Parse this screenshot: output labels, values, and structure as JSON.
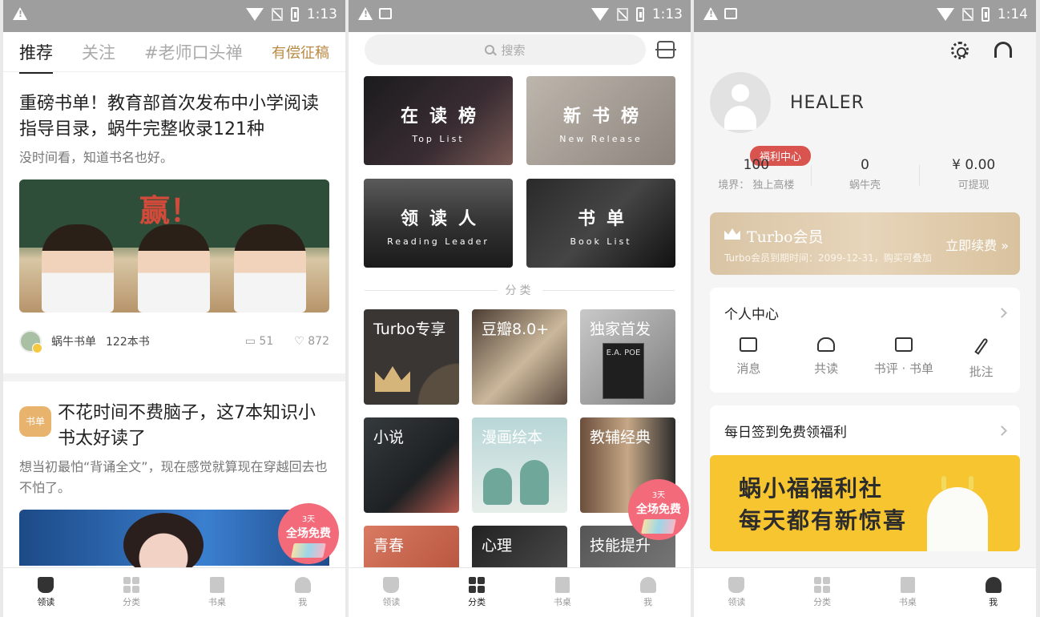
{
  "status": {
    "p1_time": "1:13",
    "p2_time": "1:13",
    "p3_time": "1:14"
  },
  "tabs": [
    "领读",
    "分类",
    "书桌",
    "我"
  ],
  "panel1": {
    "nav": [
      "推荐",
      "关注",
      "#老师口头禅",
      "有偿征稿"
    ],
    "post1": {
      "title": "重磅书单！教育部首次发布中小学阅读指导目录，蜗牛完整收录121种",
      "subtitle": "没时间看，知道书名也好。",
      "photo_text": "赢！",
      "author": "蜗牛书单",
      "book_count": "122本书",
      "comments": "51",
      "likes": "872"
    },
    "post2": {
      "tag": "书单",
      "title": "不花时间不费脑子，这7本知识小书太好读了",
      "subtitle": "想当初最怕“背诵全文”，现在感觉就算现在穿越回去也不怕了。"
    },
    "free_badge": {
      "days": "3天",
      "text": "全场免费"
    }
  },
  "panel2": {
    "search_placeholder": "搜索",
    "big_cards": [
      {
        "cn": "在读榜",
        "en": "Top List"
      },
      {
        "cn": "新书榜",
        "en": "New Release"
      },
      {
        "cn": "领读人",
        "en": "Reading Leader"
      },
      {
        "cn": "书单",
        "en": "Book List"
      }
    ],
    "section_label": "分类",
    "categories": [
      "Turbo专享",
      "豆瓣8.0+",
      "独家首发",
      "小说",
      "漫画绘本",
      "教辅经典",
      "青春",
      "心理",
      "技能提升"
    ],
    "poe_text": "E.A. POE",
    "free_badge": {
      "days": "3天",
      "text": "全场免费"
    }
  },
  "panel3": {
    "username": "HEALER",
    "welfare_badge": "福利中心",
    "stats": [
      {
        "value": "100",
        "label": "境界：  独上高楼"
      },
      {
        "value": "0",
        "label": "蜗牛壳"
      },
      {
        "value": "¥ 0.00",
        "label": "可提现"
      }
    ],
    "turbo": {
      "title": "Turbo会员",
      "desc": "Turbo会员到期时间：2099-12-31，购买可叠加",
      "action": "立即续费 »"
    },
    "personal_center": {
      "title": "个人中心",
      "items": [
        "消息",
        "共读",
        "书评 · 书单",
        "批注"
      ]
    },
    "daily": {
      "title": "每日签到免费领福利",
      "banner_line1": "蜗小福福利社",
      "banner_line2": "每天都有新惊喜"
    }
  }
}
